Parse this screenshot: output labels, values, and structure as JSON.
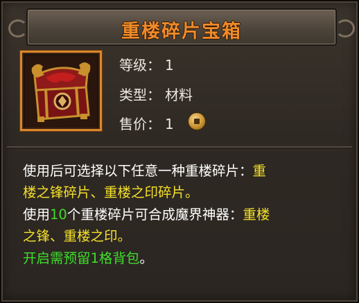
{
  "title": "重楼碎片宝箱",
  "attributes": {
    "level_label": "等级：",
    "level_value": "1",
    "type_label": "类型：",
    "type_value": "材料",
    "price_label": "售价：",
    "price_value": "1",
    "price_icon": "coin-icon"
  },
  "item_icon": "treasure-chest-icon",
  "description": {
    "line1_a": "使用后可选择以下任意一种重楼碎片：",
    "line1_b": "重",
    "line2": "楼之锋碎片、重楼之印碎片。",
    "line3_a": "使用",
    "line3_num": "10",
    "line3_b": "个重楼碎片可合成魔界神器：",
    "line3_c": "重楼",
    "line4": "之锋、重楼之印。",
    "line5": "开启需预留1格背包",
    "line5_end": "。"
  },
  "colors": {
    "title": "#f08a2a",
    "highlight_yellow": "#f4e02a",
    "highlight_green": "#3fdc2c",
    "text": "#ffffff",
    "icon_border": "#d9882c"
  }
}
